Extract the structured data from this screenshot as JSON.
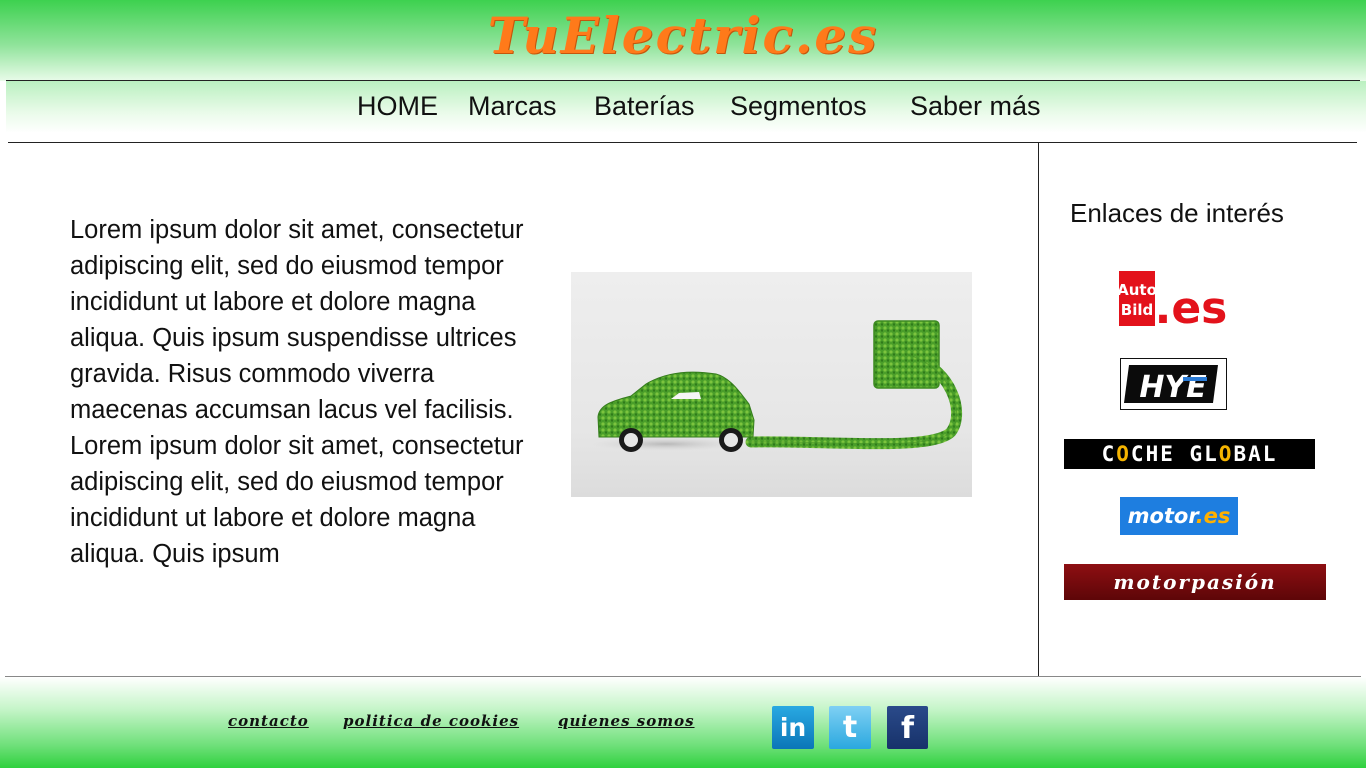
{
  "header": {
    "logo_text": "TuElectric.es"
  },
  "nav": {
    "items": [
      {
        "label": "HOME"
      },
      {
        "label": "Marcas"
      },
      {
        "label": "Baterías"
      },
      {
        "label": "Segmentos"
      },
      {
        "label": "Saber más"
      }
    ]
  },
  "main": {
    "paragraphs": [
      "Lorem ipsum dolor sit amet, consectetur adipiscing elit, sed do eiusmod tempor incididunt ut labore et dolore magna aliqua. Quis ipsum suspendisse ultrices gravida. Risus commodo viverra maecenas accumsan lacus vel facilisis.",
      "Lorem ipsum dolor sit amet, consectetur adipiscing elit, sed do eiusmod tempor incididunt ut labore et dolore magna aliqua. Quis ipsum"
    ],
    "hero_image": "green-electric-car-plugged-into-socket"
  },
  "sidebar": {
    "title": "Enlaces de interés",
    "partners": [
      {
        "name": "autobild-es-logo",
        "line1": "Auto",
        "line2": "Bild",
        "suffix": ".es"
      },
      {
        "name": "hye-logo",
        "text": "HYE"
      },
      {
        "name": "coche-global-logo",
        "text_a": "C",
        "text_o1": "O",
        "text_b": "CHE GL",
        "text_o2": "O",
        "text_c": "BAL"
      },
      {
        "name": "motor-es-logo",
        "text": "motor",
        "suffix": ".es"
      },
      {
        "name": "motorpasion-logo",
        "text": "motorpasión"
      }
    ]
  },
  "footer": {
    "links": [
      {
        "label": "contacto"
      },
      {
        "label": "politica de cookies"
      },
      {
        "label": "quienes somos"
      }
    ],
    "social": [
      {
        "name": "linkedin-icon",
        "glyph": "in"
      },
      {
        "name": "twitter-icon",
        "glyph": "t"
      },
      {
        "name": "facebook-icon",
        "glyph": "f"
      }
    ]
  },
  "colors": {
    "header_green": "#3dd14f",
    "logo_orange": "#ff7a1a",
    "footer_green": "#2fd13e"
  }
}
